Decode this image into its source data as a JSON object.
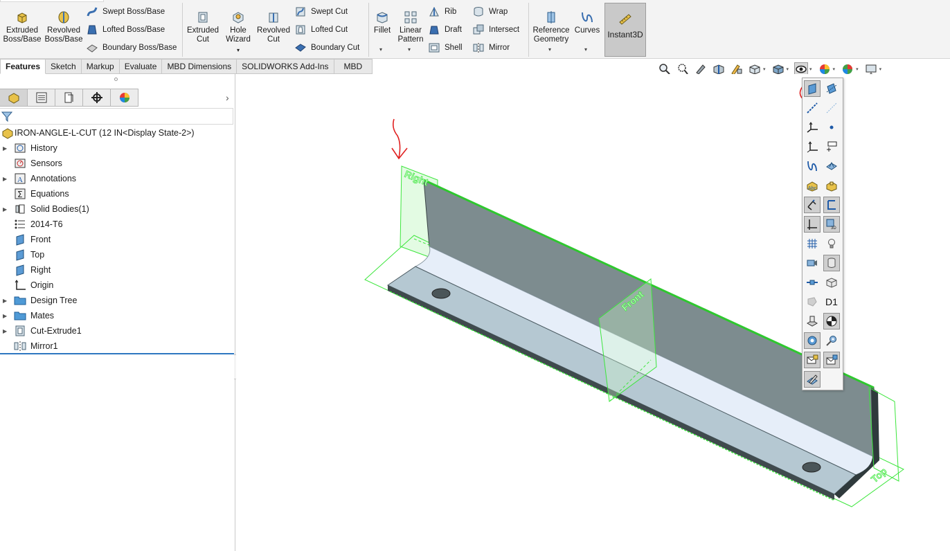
{
  "ribbon": {
    "extruded_boss": "Extruded\nBoss/Base",
    "revolved_boss": "Revolved\nBoss/Base",
    "swept_boss": "Swept Boss/Base",
    "lofted_boss": "Lofted Boss/Base",
    "boundary_boss": "Boundary Boss/Base",
    "extruded_cut": "Extruded\nCut",
    "hole_wizard": "Hole\nWizard",
    "revolved_cut": "Revolved\nCut",
    "swept_cut": "Swept Cut",
    "lofted_cut": "Lofted Cut",
    "boundary_cut": "Boundary Cut",
    "fillet": "Fillet",
    "linear_pattern": "Linear\nPattern",
    "rib": "Rib",
    "draft": "Draft",
    "shell": "Shell",
    "wrap": "Wrap",
    "intersect": "Intersect",
    "mirror": "Mirror",
    "reference_geometry": "Reference\nGeometry",
    "curves": "Curves",
    "instant3d": "Instant3D"
  },
  "tabs": [
    "Features",
    "Sketch",
    "Markup",
    "Evaluate",
    "MBD Dimensions",
    "SOLIDWORKS Add-Ins",
    "MBD"
  ],
  "tree": {
    "root": "IRON-ANGLE-L-CUT  (12 IN<Display State-2>)",
    "items": [
      "History",
      "Sensors",
      "Annotations",
      "Equations",
      "Solid Bodies(1)",
      "2014-T6",
      "Front",
      "Top",
      "Right",
      "Origin",
      "Design Tree",
      "Mates",
      "Cut-Extrude1",
      "Mirror1"
    ]
  },
  "viewport": {
    "plane_labels": [
      "Right",
      "Front",
      "Top"
    ]
  },
  "flyout": {
    "dimension_label": "D1",
    "icons": [
      "view-planes-icon",
      "view-axes-icon",
      "view-temporary-axes-icon",
      "view-points-icon",
      "view-coordinate-systems-icon",
      "view-origins-icon",
      "view-curves-icon",
      "view-sketches-icon",
      "view-annotations-icon",
      "view-all-annotations-icon",
      "view-routing-points-icon",
      "view-3d-sketch-planes-icon",
      "view-grid-icon",
      "view-lights-icon",
      "view-cameras-icon",
      "view-decal-icon",
      "view-sketch-relations-icon",
      "view-parts-icon",
      "view-weld-beads-icon",
      "view-dimension-names-icon",
      "view-sensors-icon",
      "view-center-of-mass-icon",
      "view-cosmetic-threads-icon",
      "view-mates-icon",
      "view-mail-icon",
      "view-mail-open-icon",
      "view-sketch-edit-icon"
    ]
  },
  "colors": {
    "accent": "#2e77c0",
    "plane_green": "#3ce63c",
    "annotation_red": "#e02020",
    "part_steel": "#9fb5c2"
  }
}
